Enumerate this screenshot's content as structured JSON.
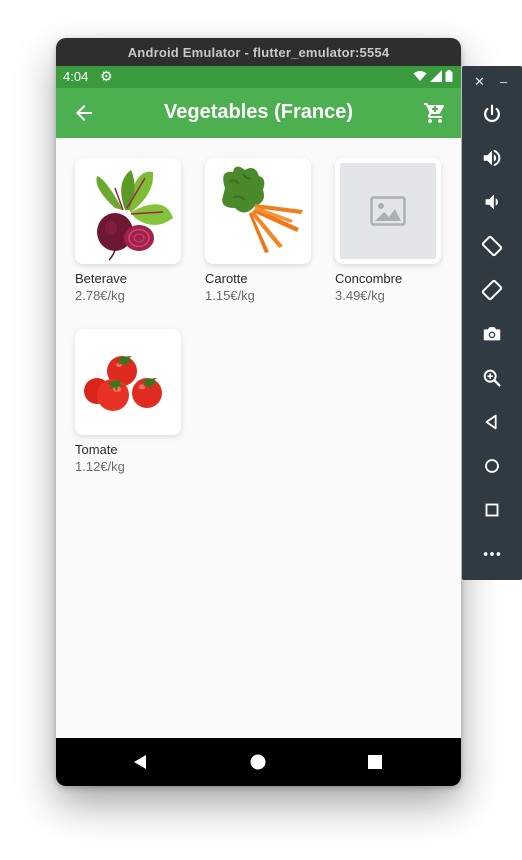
{
  "emulator": {
    "title": "Android Emulator - flutter_emulator:5554"
  },
  "status_bar": {
    "time": "4:04"
  },
  "app_bar": {
    "title": "Vegetables (France)"
  },
  "products": [
    {
      "name": "Beterave",
      "price": "2.78€/kg",
      "image": "beetroot"
    },
    {
      "name": "Carotte",
      "price": "1.15€/kg",
      "image": "carrots"
    },
    {
      "name": "Concombre",
      "price": "3.49€/kg",
      "image": "placeholder-image-icon"
    },
    {
      "name": "Tomate",
      "price": "1.12€/kg",
      "image": "tomatoes"
    }
  ],
  "colors": {
    "app_bar": "#4caf50",
    "status_bar": "#3a9b3e",
    "background": "#fafafa",
    "side_panel": "#2f3a42"
  },
  "side_controls": [
    "power-icon",
    "volume-up-icon",
    "volume-down-icon",
    "rotate-left-icon",
    "rotate-right-icon",
    "camera-icon",
    "zoom-icon",
    "back-icon",
    "home-icon",
    "overview-icon",
    "more-icon"
  ]
}
